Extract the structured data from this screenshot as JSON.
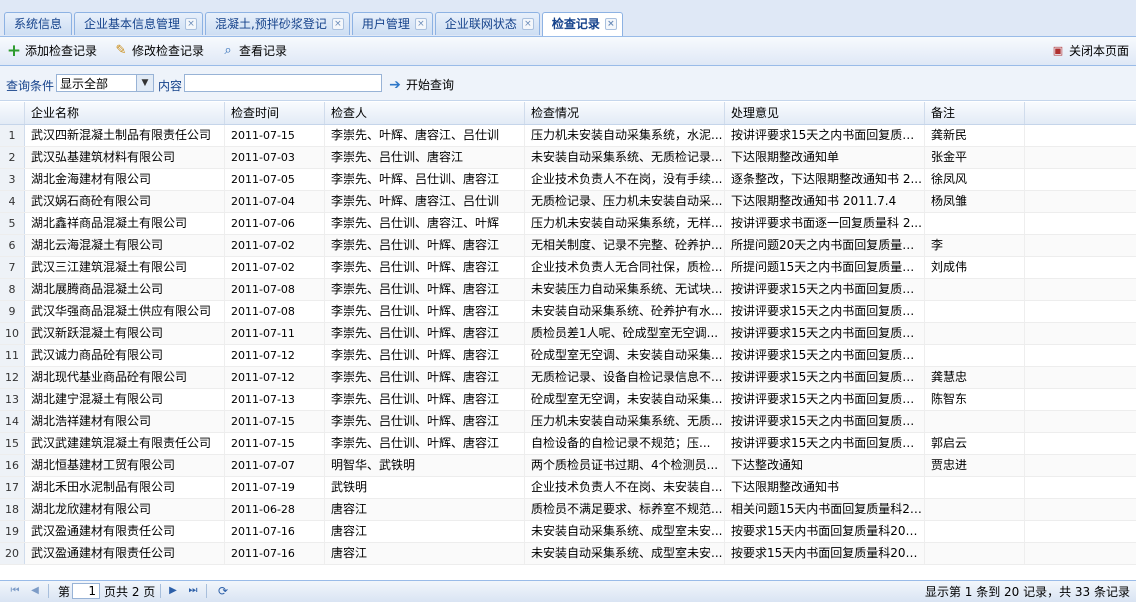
{
  "tabs": [
    {
      "label": "系统信息",
      "closable": false,
      "active": false
    },
    {
      "label": "企业基本信息管理",
      "closable": true,
      "active": false
    },
    {
      "label": "混凝土,预拌砂浆登记",
      "closable": true,
      "active": false
    },
    {
      "label": "用户管理",
      "closable": true,
      "active": false
    },
    {
      "label": "企业联网状态",
      "closable": true,
      "active": false
    },
    {
      "label": "检查记录",
      "closable": true,
      "active": true
    }
  ],
  "toolbar": {
    "add_label": "添加检查记录",
    "edit_label": "修改检查记录",
    "view_label": "查看记录",
    "close_page_label": "关闭本页面",
    "icons": {
      "add": "plus-icon",
      "edit": "pencil-icon",
      "view": "magnifier-icon",
      "close": "close-page-icon"
    }
  },
  "query": {
    "condition_label": "查询条件",
    "condition_value": "显示全部",
    "content_label": "内容",
    "content_value": "",
    "search_label": "开始查询"
  },
  "grid": {
    "columns": [
      "企业名称",
      "检查时间",
      "检查人",
      "检查情况",
      "处理意见",
      "备注"
    ],
    "rows": [
      [
        "1",
        "武汉四新混凝土制品有限责任公司",
        "2011-07-15",
        "李崇先、叶辉、唐容江、吕仕训",
        "压力机未安装自动采集系统，水泥...",
        "按讲评要求15天之内书面回复质量...",
        "龚新民"
      ],
      [
        "2",
        "武汉弘基建筑材料有限公司",
        "2011-07-03",
        "李崇先、吕仕训、唐容江",
        "未安装自动采集系统、无质检记录...",
        "下达限期整改通知单",
        "张金平"
      ],
      [
        "3",
        "湖北金海建材有限公司",
        "2011-07-05",
        "李崇先、叶辉、吕仕训、唐容江",
        "企业技术负责人不在岗，没有手续...",
        "逐条整改，下达限期整改通知书 2...",
        "徐凤风"
      ],
      [
        "4",
        "武汉娲石商砼有限公司",
        "2011-07-04",
        "李崇先、叶辉、唐容江、吕仕训",
        "无质检记录、压力机未安装自动采...",
        "下达限期整改通知书 2011.7.4",
        "杨凤雏"
      ],
      [
        "5",
        "湖北鑫祥商品混凝土有限公司",
        "2011-07-06",
        "李崇先、吕仕训、唐容江、叶辉",
        "压力机未安装自动采集系统，无样...",
        "按讲评要求书面逐一回复质量科 2...",
        ""
      ],
      [
        "6",
        "湖北云海混凝土有限公司",
        "2011-07-02",
        "李崇先、吕仕训、叶辉、唐容江",
        "无相关制度、记录不完整、砼养护...",
        "所提问题20天之内书面回复质量科...",
        "李"
      ],
      [
        "7",
        "武汉三江建筑混凝土有限公司",
        "2011-07-02",
        "李崇先、吕仕训、叶辉、唐容江",
        "企业技术负责人无合同社保，质检...",
        "所提问题15天之内书面回复质量科...",
        "刘成伟"
      ],
      [
        "8",
        "湖北展腾商品混凝土公司",
        "2011-07-08",
        "李崇先、吕仕训、叶辉、唐容江",
        "未安装压力自动采集系统、无试块...",
        "按讲评要求15天之内书面回复质量...",
        ""
      ],
      [
        "9",
        "武汉华强商品混凝土供应有限公司",
        "2011-07-08",
        "李崇先、吕仕训、叶辉、唐容江",
        "未安装自动采集系统、砼养护有水...",
        "按讲评要求15天之内书面回复质量...",
        ""
      ],
      [
        "10",
        "武汉新跃混凝土有限公司",
        "2011-07-11",
        "李崇先、吕仕训、叶辉、唐容江",
        "质检员差1人呢、砼成型室无空调...",
        "按讲评要求15天之内书面回复质量...",
        ""
      ],
      [
        "11",
        "武汉诚力商品砼有限公司",
        "2011-07-12",
        "李崇先、吕仕训、叶辉、唐容江",
        "砼成型室无空调、未安装自动采集...",
        "按讲评要求15天之内书面回复质量...",
        ""
      ],
      [
        "12",
        "湖北现代基业商品砼有限公司",
        "2011-07-12",
        "李崇先、吕仕训、叶辉、唐容江",
        "无质检记录、设备自检记录信息不...",
        "按讲评要求15天之内书面回复质量...",
        "龚慧忠"
      ],
      [
        "13",
        "湖北建宁混凝土有限公司",
        "2011-07-13",
        "李崇先、吕仕训、叶辉、唐容江",
        "砼成型室无空调，未安装自动采集...",
        "按讲评要求15天之内书面回复质量...",
        "陈智东"
      ],
      [
        "14",
        "湖北浩祥建材有限公司",
        "2011-07-15",
        "李崇先、吕仕训、叶辉、唐容江",
        "压力机未安装自动采集系统、无质...",
        "按讲评要求15天之内书面回复质量...",
        ""
      ],
      [
        "15",
        "武汉武建建筑混凝土有限责任公司",
        "2011-07-15",
        "李崇先、吕仕训、叶辉、唐容江",
        "自检设备的自检记录不规范；压...",
        "按讲评要求15天之内书面回复质量...",
        "郭启云"
      ],
      [
        "16",
        "湖北恒基建材工贸有限公司",
        "2011-07-07",
        "明智华、武铁明",
        "两个质检员证书过期、4个检测员...",
        "下达整改通知",
        "贾忠进"
      ],
      [
        "17",
        "湖北禾田水泥制品有限公司",
        "2011-07-19",
        "武铁明",
        "企业技术负责人不在岗、未安装自...",
        "下达限期整改通知书",
        ""
      ],
      [
        "18",
        "湖北龙欣建材有限公司",
        "2011-06-28",
        "唐容江",
        "质检员不满足要求、标养室不规范...",
        "相关问题15天内书面回复质量科20...",
        ""
      ],
      [
        "19",
        "武汉盈通建材有限责任公司",
        "2011-07-16",
        "唐容江",
        "未安装自动采集系统、成型室未安...",
        "按要求15天内书面回复质量科2011...",
        ""
      ],
      [
        "20",
        "武汉盈通建材有限责任公司",
        "2011-07-16",
        "唐容江",
        "未安装自动采集系统、成型室未安...",
        "按要求15天内书面回复质量科2011...",
        ""
      ]
    ]
  },
  "pager": {
    "page_prefix": "第",
    "current_page": "1",
    "page_suffix": "页共 2 页",
    "summary": "显示第 1 条到 20 记录，共 33 条记录"
  }
}
